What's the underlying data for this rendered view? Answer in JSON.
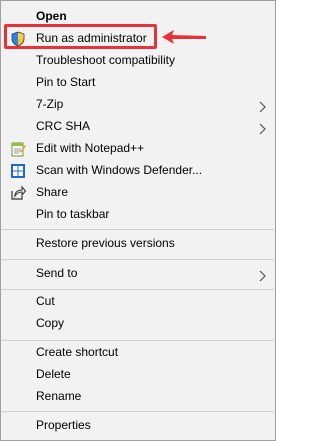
{
  "menu": {
    "open": "Open",
    "run_as_admin": "Run as administrator",
    "troubleshoot": "Troubleshoot compatibility",
    "pin_start": "Pin to Start",
    "seven_zip": "7-Zip",
    "crc_sha": "CRC SHA",
    "edit_notepad": "Edit with Notepad++",
    "scan_defender": "Scan with Windows Defender...",
    "share": "Share",
    "pin_taskbar": "Pin to taskbar",
    "restore_versions": "Restore previous versions",
    "send_to": "Send to",
    "cut": "Cut",
    "copy": "Copy",
    "create_shortcut": "Create shortcut",
    "delete": "Delete",
    "rename": "Rename",
    "properties": "Properties"
  },
  "icons": {
    "run_as_admin": "uac-shield-icon",
    "edit_notepad": "notepad-plus-plus-icon",
    "scan_defender": "windows-defender-icon",
    "share": "share-icon",
    "submenu": "chevron-right-icon"
  },
  "annotation": {
    "highlight_color": "#e5323b"
  }
}
